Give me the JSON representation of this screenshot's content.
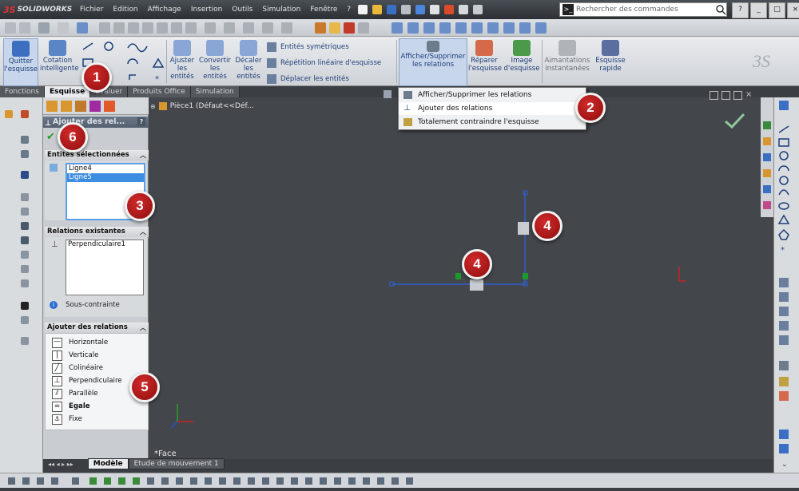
{
  "app": {
    "brand_ds": "3S",
    "brand_name": "SOLIDWORKS"
  },
  "menu": [
    "Fichier",
    "Edition",
    "Affichage",
    "Insertion",
    "Outils",
    "Simulation",
    "Fenêtre",
    "?"
  ],
  "search": {
    "placeholder": "Rechercher des commandes"
  },
  "window_buttons": [
    "?",
    "_",
    "□",
    "×"
  ],
  "command_manager": {
    "quit_sketch": "Quitter l'esquisse",
    "smart_dimension": "Cotation intelligente",
    "trim": "Ajuster les entités",
    "convert": "Convertir les entités",
    "offset": "Décaler les entités",
    "mirror": "Entités symétriques",
    "linear_pattern": "Répétition linéaire d'esquisse",
    "move": "Déplacer les entités",
    "relations": "Afficher/Supprimer les relations",
    "repair": "Réparer l'esquisse",
    "image": "Image d'esquisse",
    "snaps": "Aimantations instantanées",
    "rapid": "Esquisse rapide"
  },
  "tabs": [
    "Fonctions",
    "Esquisse",
    "Evaluer",
    "Produits Office",
    "Simulation"
  ],
  "active_tab": "Esquisse",
  "dropdown": {
    "items": [
      "Afficher/Supprimer les relations",
      "Ajouter des relations",
      "Totalement contraindre l'esquisse"
    ],
    "highlighted": "Ajouter des relations"
  },
  "tree": {
    "part": "Pièce1 (Défaut<<Déf..."
  },
  "property_manager": {
    "title": "Ajouter des rel...",
    "help": "?",
    "ok_icon": "check-icon",
    "selected_entities": {
      "heading": "Entités sélectionnées",
      "items": [
        "Ligne4",
        "Ligne5"
      ],
      "selected": "Ligne5"
    },
    "existing_relations": {
      "heading": "Relations existantes",
      "items": [
        "Perpendiculaire1"
      ],
      "status": "Sous-contrainte"
    },
    "add_relations": {
      "heading": "Ajouter des relations",
      "items": [
        "Horizontale",
        "Verticale",
        "Colinéaire",
        "Perpendiculaire",
        "Parallèle",
        "Egale",
        "Fixe"
      ],
      "bold": "Egale"
    }
  },
  "graphics": {
    "face_label": "*Face"
  },
  "bottom_tabs": [
    "Modèle",
    "Etude de mouvement 1"
  ],
  "markers": [
    "1",
    "2",
    "3",
    "4",
    "4",
    "5",
    "6"
  ],
  "colors": {
    "accent": "#3d8ee0",
    "marker": "#b01818",
    "sketch_line": "#2d5fd0",
    "constraint": "#1a9a2a"
  }
}
